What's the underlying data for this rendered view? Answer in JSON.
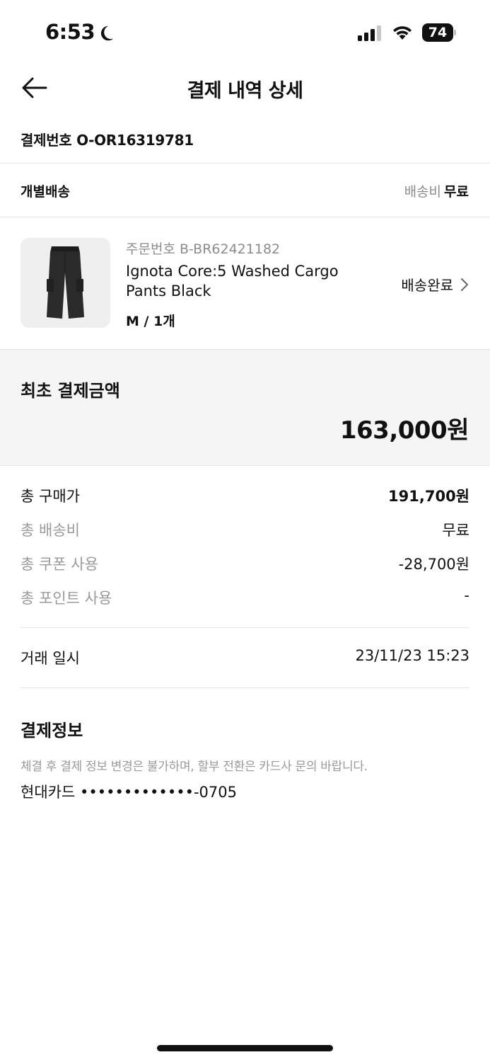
{
  "status_bar": {
    "time": "6:53",
    "battery": "74",
    "icons": [
      "moon-icon",
      "signal-icon",
      "wifi-icon",
      "battery-icon"
    ]
  },
  "header": {
    "title": "결제 내역 상세",
    "back_icon": "arrow-left-icon"
  },
  "payment": {
    "number_label": "결제번호",
    "number_value": "O-OR16319781"
  },
  "shipping": {
    "label": "개별배송",
    "fee_label": "배송비",
    "fee_value": "무료"
  },
  "product": {
    "order_number": "주문번호 B-BR62421182",
    "name": "Ignota Core:5 Washed Cargo Pants Black",
    "option": "M / 1개",
    "status": "배송완료",
    "status_icon": "chevron-right-icon"
  },
  "initial_amount": {
    "label": "최초 결제금액",
    "value": "163,000원"
  },
  "summary": {
    "total_price_label": "총 구매가",
    "total_price_value": "191,700원",
    "total_shipping_label": "총 배송비",
    "total_shipping_value": "무료",
    "coupon_label": "총 쿠폰 사용",
    "coupon_value": "-28,700원",
    "points_label": "총 포인트 사용",
    "points_value": "-"
  },
  "transaction": {
    "label": "거래 일시",
    "value": "23/11/23 15:23"
  },
  "payment_info": {
    "title": "결제정보",
    "note": "체결 후 결제 정보 변경은 불가하며, 할부 전환은 카드사 문의 바랍니다.",
    "card": "현대카드 •••••••••••••-0705"
  }
}
